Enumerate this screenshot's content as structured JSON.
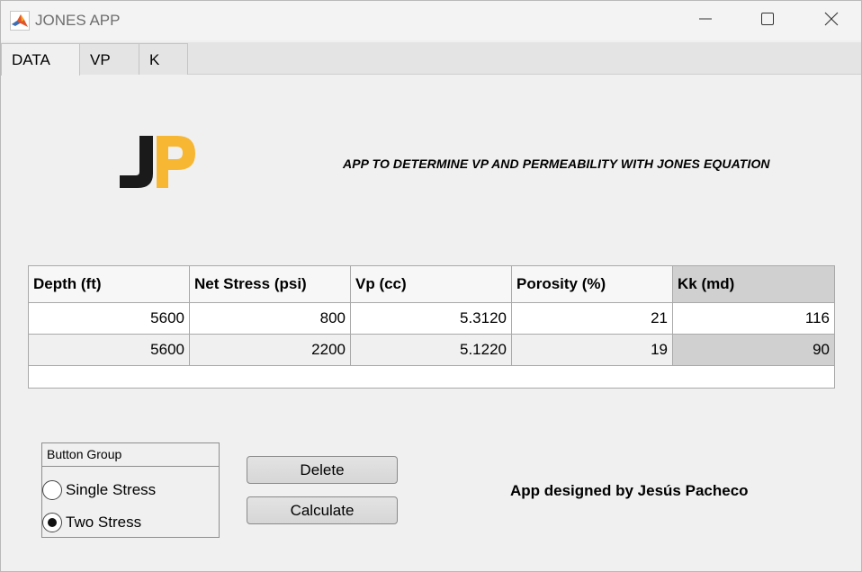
{
  "window": {
    "title": "JONES APP",
    "app_icon": "matlab-icon",
    "controls": [
      "minimize-icon",
      "maximize-icon",
      "close-icon"
    ]
  },
  "tabs": [
    {
      "label": "DATA",
      "active": true
    },
    {
      "label": "VP",
      "active": false
    },
    {
      "label": "K",
      "active": false
    }
  ],
  "logo": {
    "text": "JP",
    "colors": {
      "J": "#1a1a1a",
      "P": "#f7b733"
    }
  },
  "heading": "APP TO DETERMINE VP AND PERMEABILITY WITH JONES EQUATION",
  "table": {
    "columns": [
      "Depth (ft)",
      "Net Stress (psi)",
      "Vp (cc)",
      "Porosity (%)",
      "Kk (md)"
    ],
    "rows": [
      [
        "5600",
        "800",
        "5.3120",
        "21",
        "116"
      ],
      [
        "5600",
        "2200",
        "5.1220",
        "19",
        "90"
      ]
    ],
    "selected_column": 4
  },
  "button_group": {
    "title": "Button Group",
    "options": [
      {
        "label": "Single Stress",
        "selected": false
      },
      {
        "label": "Two Stress",
        "selected": true
      }
    ]
  },
  "buttons": {
    "delete_label": "Delete",
    "calculate_label": "Calculate"
  },
  "credit": "App designed by Jesús Pacheco"
}
